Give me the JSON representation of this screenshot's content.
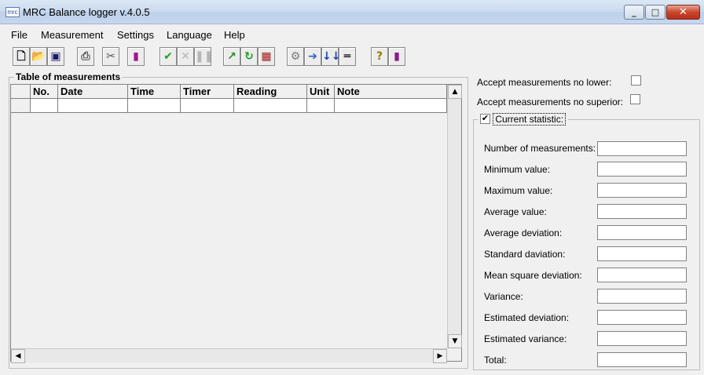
{
  "window": {
    "title": "MRC Balance logger v.4.0.5",
    "icon_text": "mrc"
  },
  "menu": [
    "File",
    "Measurement",
    "Settings",
    "Language",
    "Help"
  ],
  "toolbar_icons": [
    "new-file-icon",
    "open-folder-icon",
    "save-icon",
    "print-icon",
    "tools-icon",
    "chart-icon",
    "accept-check-icon",
    "reject-x-icon",
    "pause-icon",
    "step-icon",
    "refresh-icon",
    "stats-icon",
    "connect-icon",
    "export-icon",
    "arrows-down-icon",
    "equals-icon",
    "help-icon",
    "book-icon"
  ],
  "table": {
    "legend": "Table of measurements",
    "columns": [
      "No.",
      "Date",
      "Time",
      "Timer",
      "Reading",
      "Unit",
      "Note"
    ]
  },
  "filters": {
    "no_lower": "Accept measurements no lower:",
    "no_superior": "Accept measurements no superior:"
  },
  "statistic": {
    "title": "Current statistic:",
    "items": [
      "Number of measurements:",
      "Minimum value:",
      "Maximum value:",
      "Average value:",
      "Average deviation:",
      "Standard daviation:",
      "Mean square deviation:",
      "Variance:",
      "Estimated  deviation:",
      "Estimated  variance:",
      "Total:"
    ]
  }
}
